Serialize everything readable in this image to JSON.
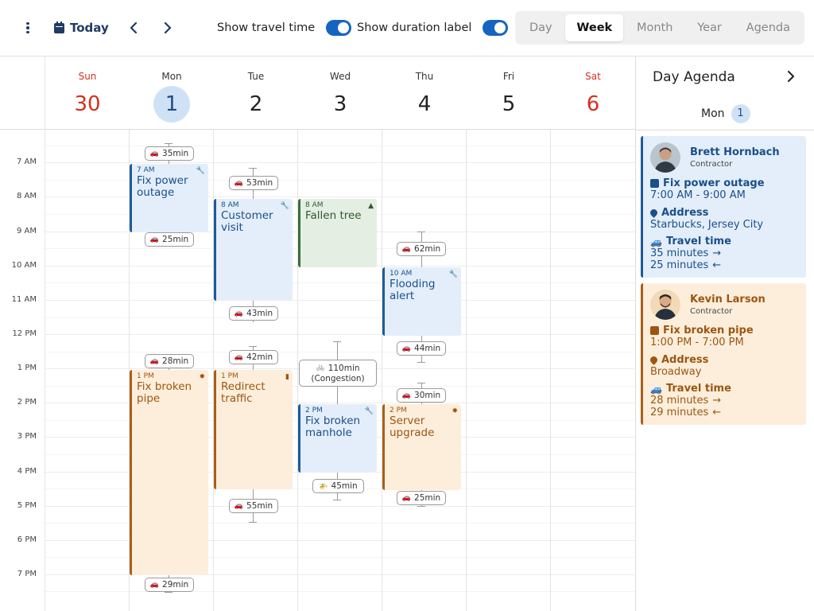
{
  "toolbar": {
    "today_label": "Today",
    "show_travel_label": "Show travel time",
    "show_duration_label": "Show duration label",
    "views": [
      "Day",
      "Week",
      "Month",
      "Year",
      "Agenda"
    ],
    "active_view": "Week"
  },
  "week": {
    "days": [
      {
        "dow": "Sun",
        "num": "30"
      },
      {
        "dow": "Mon",
        "num": "1"
      },
      {
        "dow": "Tue",
        "num": "2"
      },
      {
        "dow": "Wed",
        "num": "3"
      },
      {
        "dow": "Thu",
        "num": "4"
      },
      {
        "dow": "Fri",
        "num": "5"
      },
      {
        "dow": "Sat",
        "num": "6"
      }
    ],
    "current_day": "Mon"
  },
  "time_labels": [
    "7 AM",
    "8 AM",
    "9 AM",
    "10 AM",
    "11 AM",
    "12 PM",
    "1 PM",
    "2 PM",
    "3 PM",
    "4 PM",
    "5 PM",
    "6 PM",
    "7 PM"
  ],
  "events": [
    {
      "time": "7 AM",
      "title": "Fix power outage",
      "icon": "wrench-icon"
    },
    {
      "time": "1 PM",
      "title": "Fix broken pipe",
      "icon": "gear-icon"
    },
    {
      "time": "8 AM",
      "title": "Customer visit",
      "icon": "wrench-icon"
    },
    {
      "time": "1 PM",
      "title": "Redirect traffic",
      "icon": "traffic-light-icon"
    },
    {
      "time": "8 AM",
      "title": "Fallen tree",
      "icon": "tree-icon"
    },
    {
      "time": "2 PM",
      "title": "Fix broken manhole",
      "icon": "wrench-icon"
    },
    {
      "time": "10 AM",
      "title": "Flooding alert",
      "icon": "wrench-icon"
    },
    {
      "time": "2 PM",
      "title": "Server upgrade",
      "icon": "gear-icon"
    }
  ],
  "travel_chips": [
    {
      "label": "35min",
      "vehicle": "car-icon"
    },
    {
      "label": "25min",
      "vehicle": "car-icon"
    },
    {
      "label": "28min",
      "vehicle": "car-icon"
    },
    {
      "label": "29min",
      "vehicle": "car-icon"
    },
    {
      "label": "53min",
      "vehicle": "car-icon"
    },
    {
      "label": "43min",
      "vehicle": "car-icon"
    },
    {
      "label": "42min",
      "vehicle": "car-icon"
    },
    {
      "label": "55min",
      "vehicle": "car-icon"
    },
    {
      "label": "110min",
      "sublabel": "(Congestion)",
      "vehicle": "bicycle-icon"
    },
    {
      "label": "45min",
      "vehicle": "helicopter-icon"
    },
    {
      "label": "62min",
      "vehicle": "car-icon"
    },
    {
      "label": "44min",
      "vehicle": "car-icon"
    },
    {
      "label": "30min",
      "vehicle": "car-icon"
    },
    {
      "label": "25min",
      "vehicle": "car-icon"
    }
  ],
  "agenda": {
    "title": "Day Agenda",
    "day_dow": "Mon",
    "day_num": "1",
    "cards": [
      {
        "name": "Brett Hornbach",
        "role": "Contractor",
        "event_title": "Fix power outage",
        "time_range": "7:00 AM - 9:00 AM",
        "address_label": "Address",
        "address": "Starbucks, Jersey City",
        "travel_label": "Travel time",
        "travel_to": "35 minutes",
        "travel_from": "25 minutes"
      },
      {
        "name": "Kevin Larson",
        "role": "Contractor",
        "event_title": "Fix broken pipe",
        "time_range": "1:00 PM - 7:00 PM",
        "address_label": "Address",
        "address": "Broadway",
        "travel_label": "Travel time",
        "travel_to": "28 minutes",
        "travel_from": "29 minutes"
      }
    ]
  },
  "colors": {
    "accent": "#1565c0",
    "event_blue": "#e3eefa",
    "event_orange": "#fdeedc",
    "event_green": "#e4eee3",
    "weekend": "#d7301f"
  }
}
